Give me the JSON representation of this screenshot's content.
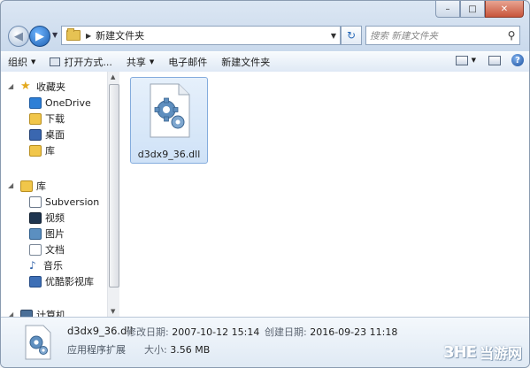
{
  "window": {
    "controls": {
      "minimize": "–",
      "maximize": "□",
      "close": "✕"
    }
  },
  "address": {
    "path": "新建文件夹",
    "search_placeholder": "搜索 新建文件夹"
  },
  "toolbar": {
    "organize": "组织",
    "open_with": "打开方式...",
    "share": "共享",
    "email": "电子邮件",
    "new_folder": "新建文件夹"
  },
  "sidebar": {
    "favorites": "收藏夹",
    "onedrive": "OneDrive",
    "downloads": "下载",
    "desktop": "桌面",
    "library_fav": "库",
    "library": "库",
    "subversion": "Subversion",
    "videos": "视频",
    "pictures": "图片",
    "documents": "文档",
    "music": "音乐",
    "youku": "优酷影视库",
    "computer": "计算机"
  },
  "file": {
    "name": "d3dx9_36.dll"
  },
  "details": {
    "name": "d3dx9_36.dll",
    "type": "应用程序扩展",
    "modified_label": "修改日期:",
    "modified_value": "2007-10-12 15:14",
    "size_label": "大小:",
    "size_value": "3.56 MB",
    "created_label": "创建日期:",
    "created_value": "2016-09-23 11:18"
  },
  "watermark": {
    "logo": "3HE",
    "text": "当游网"
  },
  "colors": {
    "selection": "#cfe2f7",
    "accent": "#1d5fb0"
  }
}
